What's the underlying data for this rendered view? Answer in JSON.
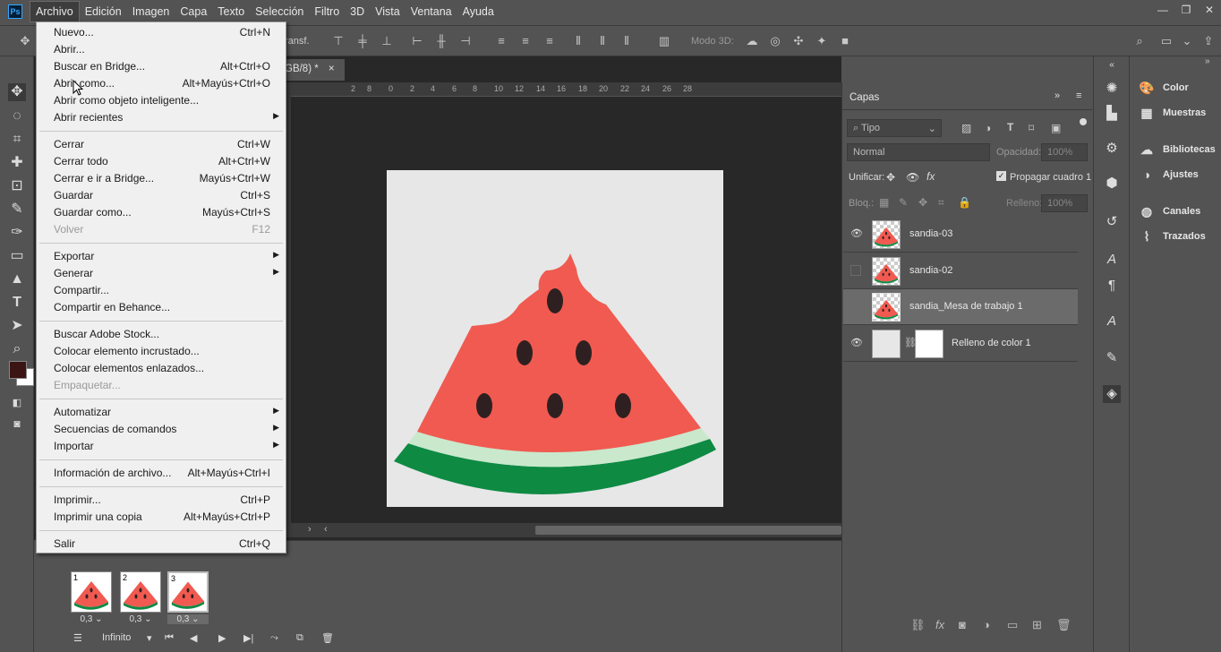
{
  "menubar": {
    "logo": "Ps",
    "items": [
      "Archivo",
      "Edición",
      "Imagen",
      "Capa",
      "Texto",
      "Selección",
      "Filtro",
      "3D",
      "Vista",
      "Ventana",
      "Ayuda"
    ]
  },
  "optbar": {
    "transform_label": "ransf.",
    "mode3d_label": "Modo 3D:"
  },
  "doc_tab": {
    "title": "GB/8) *",
    "close": "×"
  },
  "ruler_ticks": [
    "2",
    "8",
    "6",
    "4",
    "2",
    "0",
    "2",
    "4",
    "6",
    "8",
    "10",
    "12",
    "14",
    "16",
    "18",
    "20",
    "22",
    "24",
    "26",
    "28"
  ],
  "file_menu": {
    "items": [
      {
        "label": "Nuevo...",
        "shortcut": "Ctrl+N"
      },
      {
        "label": "Abrir...",
        "shortcut": ""
      },
      {
        "label": "Buscar en Bridge...",
        "shortcut": "Alt+Ctrl+O"
      },
      {
        "label": "Abrir como...",
        "shortcut": "Alt+Mayús+Ctrl+O"
      },
      {
        "label": "Abrir como objeto inteligente...",
        "shortcut": ""
      },
      {
        "label": "Abrir recientes",
        "shortcut": "",
        "submenu": true
      },
      {
        "label": "Cerrar",
        "shortcut": "Ctrl+W"
      },
      {
        "label": "Cerrar todo",
        "shortcut": "Alt+Ctrl+W"
      },
      {
        "label": "Cerrar e ir a Bridge...",
        "shortcut": "Mayús+Ctrl+W"
      },
      {
        "label": "Guardar",
        "shortcut": "Ctrl+S"
      },
      {
        "label": "Guardar como...",
        "shortcut": "Mayús+Ctrl+S"
      },
      {
        "label": "Volver",
        "shortcut": "F12",
        "disabled": true
      },
      {
        "label": "Exportar",
        "shortcut": "",
        "submenu": true
      },
      {
        "label": "Generar",
        "shortcut": "",
        "submenu": true
      },
      {
        "label": "Compartir...",
        "shortcut": ""
      },
      {
        "label": "Compartir en Behance...",
        "shortcut": ""
      },
      {
        "label": "Buscar Adobe Stock...",
        "shortcut": ""
      },
      {
        "label": "Colocar elemento incrustado...",
        "shortcut": ""
      },
      {
        "label": "Colocar elementos enlazados...",
        "shortcut": ""
      },
      {
        "label": "Empaquetar...",
        "shortcut": "",
        "disabled": true
      },
      {
        "label": "Automatizar",
        "shortcut": "",
        "submenu": true
      },
      {
        "label": "Secuencias de comandos",
        "shortcut": "",
        "submenu": true
      },
      {
        "label": "Importar",
        "shortcut": "",
        "submenu": true
      },
      {
        "label": "Información de archivo...",
        "shortcut": "Alt+Mayús+Ctrl+I"
      },
      {
        "label": "Imprimir...",
        "shortcut": "Ctrl+P"
      },
      {
        "label": "Imprimir una copia",
        "shortcut": "Alt+Mayús+Ctrl+P"
      },
      {
        "label": "Salir",
        "shortcut": "Ctrl+Q"
      }
    ]
  },
  "layers_panel": {
    "tab": "Capas",
    "filter_label": "Tipo",
    "blend_mode": "Normal",
    "opacity_label": "Opacidad:",
    "opacity_value": "100%",
    "unify_label": "Unificar:",
    "propagate_label": "Propagar cuadro 1",
    "lock_label": "Bloq.:",
    "fill_label": "Relleno:",
    "fill_value": "100%",
    "layers": [
      {
        "name": "sandia-03",
        "visible": true,
        "selected": false
      },
      {
        "name": "sandia-02",
        "visible": false,
        "selected": false
      },
      {
        "name": "sandia_Mesa de trabajo 1",
        "visible": false,
        "selected": true
      },
      {
        "name": "Relleno de color 1",
        "visible": true,
        "selected": false
      }
    ]
  },
  "right_panel": {
    "items": [
      {
        "label": "Color",
        "icon": "palette-icon"
      },
      {
        "label": "Muestras",
        "icon": "swatches-grid-icon"
      },
      {
        "label": "Bibliotecas",
        "icon": "libraries-icon"
      },
      {
        "label": "Ajustes",
        "icon": "adjustments-icon"
      },
      {
        "label": "Canales",
        "icon": "channels-icon"
      },
      {
        "label": "Trazados",
        "icon": "paths-icon"
      }
    ]
  },
  "timeline": {
    "frames": [
      {
        "num": "1",
        "delay": "0,3"
      },
      {
        "num": "2",
        "delay": "0,3"
      },
      {
        "num": "3",
        "delay": "0,3"
      }
    ],
    "loop": "Infinito"
  },
  "colors": {
    "watermelon_flesh": "#f05a50",
    "watermelon_rind": "#0e8a43",
    "watermelon_pale": "#c9e8cc",
    "seed": "#2e2020",
    "foreground_swatch": "#3b1414",
    "accent": "#31a8ff"
  }
}
